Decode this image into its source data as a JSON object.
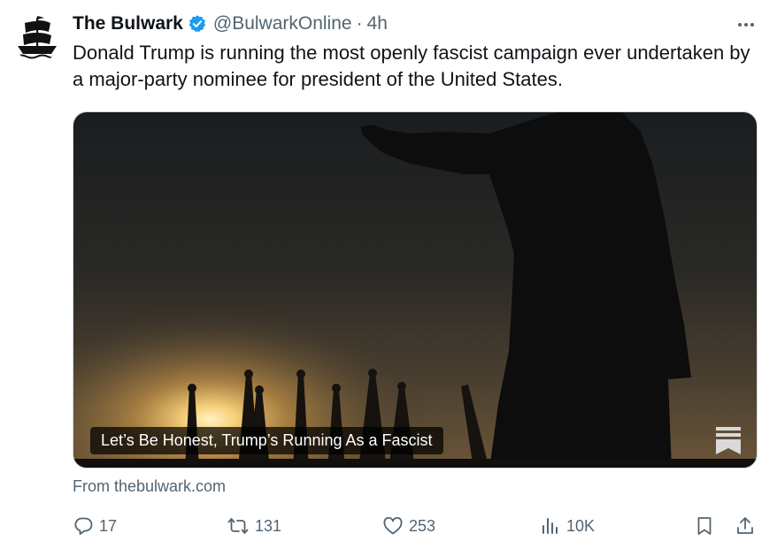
{
  "author": {
    "name": "The Bulwark",
    "handle": "@BulwarkOnline",
    "separator": "·",
    "time": "4h",
    "avatar_icon": "pirate-ship-icon",
    "verified_icon": "verified-badge-icon",
    "verified_color": "#1d9bf0"
  },
  "tweet": {
    "text": "Donald Trump is running the most openly fascist campaign ever undertaken by a major-party nominee for president of the United States."
  },
  "card": {
    "title": "Let’s Be Honest, Trump’s Running As a Fascist",
    "image_icon": "silhouette-sunset-photo",
    "logo_icon": "bulwark-bookmark-logo-icon"
  },
  "source": {
    "text": "From thebulwark.com"
  },
  "actions": {
    "reply": {
      "icon": "reply-icon",
      "count": "17"
    },
    "retweet": {
      "icon": "retweet-icon",
      "count": "131"
    },
    "like": {
      "icon": "heart-icon",
      "count": "253"
    },
    "views": {
      "icon": "views-chart-icon",
      "count": "10K"
    },
    "bookmark": {
      "icon": "bookmark-icon"
    },
    "share": {
      "icon": "share-icon"
    }
  },
  "colors": {
    "text_primary": "#0f1419",
    "text_secondary": "#536471",
    "border": "#cfd9de",
    "accent": "#1d9bf0"
  }
}
